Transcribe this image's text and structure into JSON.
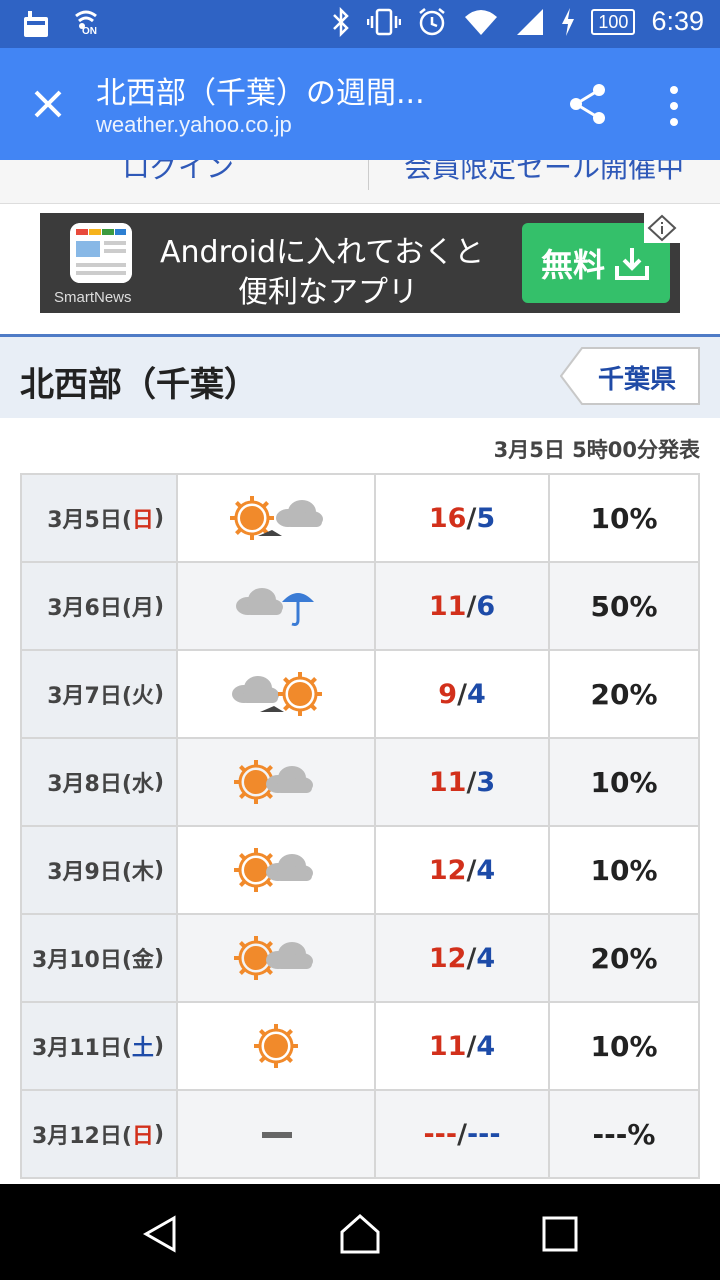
{
  "status_bar": {
    "time": "6:39",
    "battery": "100",
    "nfc_label": "ON",
    "icons_left": [
      "notification-icon",
      "nfc-icon"
    ],
    "icons_right": [
      "bluetooth-icon",
      "vibrate-icon",
      "alarm-icon",
      "wifi-icon",
      "signal-icon",
      "charging-icon"
    ]
  },
  "toolbar": {
    "title": "北西部（千葉）の週間...",
    "url": "weather.yahoo.co.jp"
  },
  "top_links": {
    "login": "ログイン",
    "sale": "会員限定セール開催中"
  },
  "ad": {
    "brand": "SmartNews",
    "line1": "Androidに入れておくと",
    "line2": "便利なアプリ",
    "button": "無料"
  },
  "region": {
    "name": "北西部（千葉）",
    "prefecture": "千葉県"
  },
  "announcement": "3月5日 5時00分発表",
  "colors": {
    "high_temp": "#d2301b",
    "low_temp": "#1d4ba8",
    "sunday": "#d2301b",
    "saturday": "#1d4ba8",
    "sun_icon": "#f18a2b",
    "cloud_icon": "#b9b9b9",
    "umbrella_icon": "#3a7bd5"
  },
  "forecast": [
    {
      "date": "3月5日(",
      "weekday": "日",
      "close": ")",
      "day_type": "sunday",
      "weather": "sun-then-cloud",
      "high": "16",
      "low": "5",
      "rain": "10%"
    },
    {
      "date": "3月6日(",
      "weekday": "月",
      "close": ")",
      "day_type": "weekday",
      "weather": "cloud-with-rain",
      "high": "11",
      "low": "6",
      "rain": "50%"
    },
    {
      "date": "3月7日(",
      "weekday": "火",
      "close": ")",
      "day_type": "weekday",
      "weather": "cloud-then-sun",
      "high": "9",
      "low": "4",
      "rain": "20%"
    },
    {
      "date": "3月8日(",
      "weekday": "水",
      "close": ")",
      "day_type": "weekday",
      "weather": "sun-with-cloud",
      "high": "11",
      "low": "3",
      "rain": "10%"
    },
    {
      "date": "3月9日(",
      "weekday": "木",
      "close": ")",
      "day_type": "weekday",
      "weather": "sun-with-cloud",
      "high": "12",
      "low": "4",
      "rain": "10%"
    },
    {
      "date": "3月10日(",
      "weekday": "金",
      "close": ")",
      "day_type": "weekday",
      "weather": "sun-with-cloud",
      "high": "12",
      "low": "4",
      "rain": "20%"
    },
    {
      "date": "3月11日(",
      "weekday": "土",
      "close": ")",
      "day_type": "saturday",
      "weather": "sun",
      "high": "11",
      "low": "4",
      "rain": "10%"
    },
    {
      "date": "3月12日(",
      "weekday": "日",
      "close": ")",
      "day_type": "sunday",
      "weather": "none",
      "high": "---",
      "low": "---",
      "rain": "---%"
    }
  ],
  "nav_bar": [
    "back-icon",
    "home-icon",
    "recents-icon"
  ]
}
